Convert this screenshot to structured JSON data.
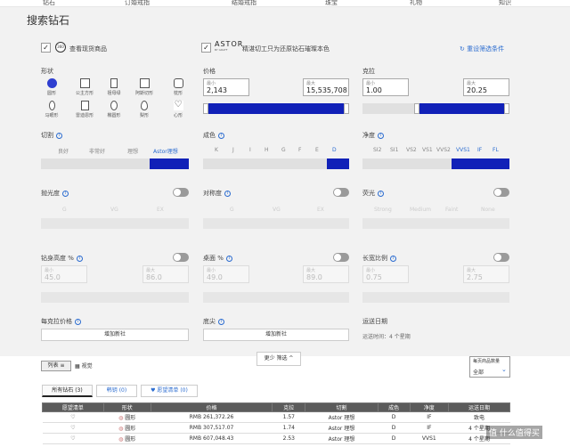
{
  "nav": [
    "钻石",
    "订婚戒指",
    "结婚戒指",
    "珠宝",
    "礼物",
    "知识"
  ],
  "title": "搜索钻石",
  "options": {
    "in_stock": "查看现货商品",
    "in_stock_badge": "360",
    "astor_logo": "ASTOR",
    "astor_sub": "BY GRAFF",
    "astor": "精湛切工只为还原钻石璀璨本色",
    "reset": "重设筛选条件"
  },
  "shape": {
    "label": "形状",
    "items": [
      "圆形",
      "公主方形",
      "祖母绿",
      "阿斯切形",
      "枕形",
      "马眼形",
      "雷迪恩形",
      "椭圆形",
      "梨形",
      "心形"
    ]
  },
  "price": {
    "label": "价格",
    "min_label": "最小",
    "min": "2,143",
    "max_label": "最大",
    "max": "15,535,708"
  },
  "carat": {
    "label": "克拉",
    "min_label": "最小",
    "min": "1.00",
    "max_label": "最大",
    "max": "20.25"
  },
  "cut": {
    "label": "切割",
    "items": [
      "良好",
      "非常好",
      "理想",
      "Astor理想"
    ]
  },
  "color": {
    "label": "成色",
    "items": [
      "K",
      "J",
      "I",
      "H",
      "G",
      "F",
      "E",
      "D"
    ]
  },
  "clarity": {
    "label": "净度",
    "items": [
      "SI2",
      "SI1",
      "VS2",
      "VS1",
      "VVS2",
      "VVS1",
      "IF",
      "FL"
    ]
  },
  "polish": {
    "label": "抛光度",
    "items": [
      "G",
      "VG",
      "EX"
    ]
  },
  "symmetry": {
    "label": "对称度",
    "items": [
      "G",
      "VG",
      "EX"
    ]
  },
  "fluor": {
    "label": "荧光",
    "items": [
      "Strong",
      "Medium",
      "Faint",
      "None"
    ]
  },
  "depth": {
    "label": "钻身高度 %",
    "min_label": "最小",
    "min": "45.0",
    "max_label": "最大",
    "max": "86.0"
  },
  "table_pct": {
    "label": "桌面 %",
    "min_label": "最小",
    "min": "49.0",
    "max_label": "最大",
    "max": "89.0"
  },
  "lw": {
    "label": "长宽比例",
    "min_label": "最小",
    "min": "0.75",
    "max_label": "最大",
    "max": "2.75"
  },
  "ppc": {
    "label": "每克拉价格",
    "btn": "增加新社"
  },
  "culet": {
    "label": "底尖",
    "btn": "增加新社"
  },
  "ship": {
    "label": "运送日期",
    "text": "运送时间：4 个星期"
  },
  "toolbar": {
    "list": "列表",
    "grid": "视觉",
    "less": "更少 筛选",
    "per_page_label": "每页商品数量",
    "per_page": "全部"
  },
  "tabs": {
    "all": "所有钻石 (3)",
    "compare": "韩钥 (0)",
    "wish": "♥ 愿望清单 (0)"
  },
  "results": {
    "headers": [
      "愿望清单",
      "形状",
      "价格",
      "克拉",
      "切割",
      "成色",
      "净度",
      "运送日期"
    ],
    "rows": [
      [
        "圆形",
        "RMB 261,372.26",
        "1.57",
        "Astor 理想",
        "D",
        "IF",
        "致电"
      ],
      [
        "圆形",
        "RMB 307,517.07",
        "1.74",
        "Astor 理想",
        "D",
        "IF",
        "4 个星期"
      ],
      [
        "圆形",
        "RMB 607,048.43",
        "2.53",
        "Astor 理想",
        "D",
        "VVS1",
        "4 个星期"
      ]
    ]
  },
  "watermark": "值 什么值得买"
}
